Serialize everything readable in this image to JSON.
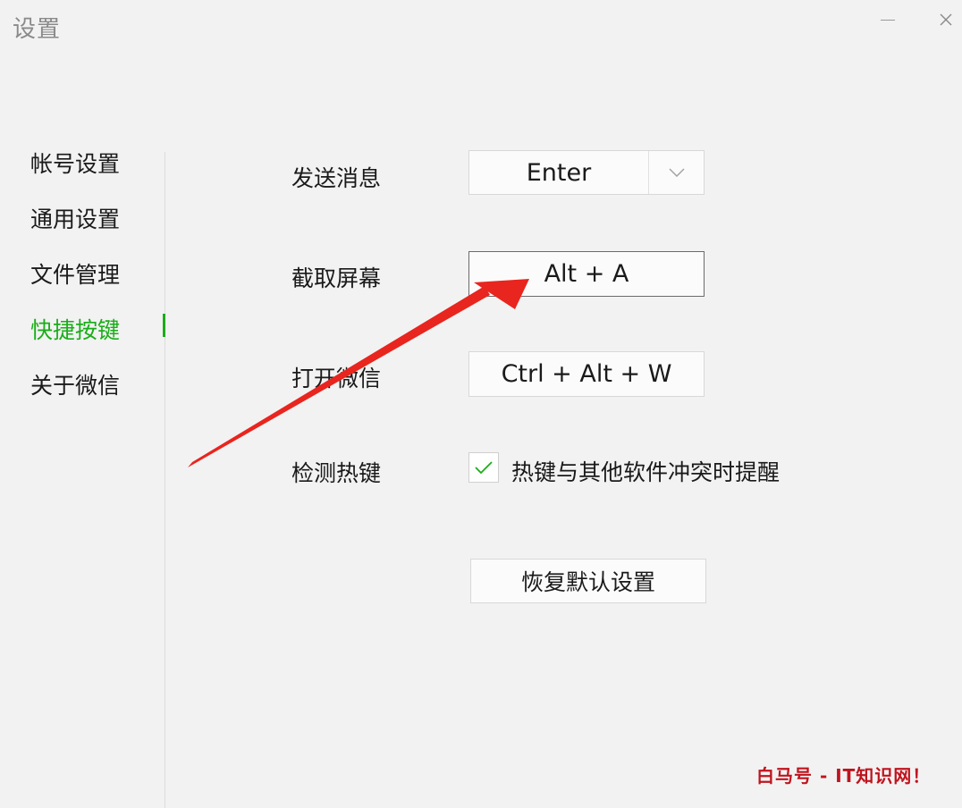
{
  "window": {
    "title": "设置",
    "minimize_icon": "minimize-icon",
    "close_icon": "close-icon"
  },
  "sidebar": {
    "items": [
      {
        "label": "帐号设置",
        "active": false
      },
      {
        "label": "通用设置",
        "active": false
      },
      {
        "label": "文件管理",
        "active": false
      },
      {
        "label": "快捷按键",
        "active": true
      },
      {
        "label": "关于微信",
        "active": false
      }
    ],
    "active_color": "#1aad19"
  },
  "shortcuts": {
    "send_message": {
      "label": "发送消息",
      "value": "Enter",
      "dropdown_icon": "chevron-down-icon"
    },
    "screenshot": {
      "label": "截取屏幕",
      "value": "Alt + A"
    },
    "open_wechat": {
      "label": "打开微信",
      "value": "Ctrl + Alt + W"
    },
    "detect_hotkey": {
      "label": "检测热键",
      "checkbox_label": "热键与其他软件冲突时提醒",
      "checked": true,
      "check_icon": "checkmark-icon"
    }
  },
  "reset_button": {
    "label": "恢复默认设置"
  },
  "annotation": {
    "arrow_icon": "red-arrow-icon",
    "color": "#e8251e"
  },
  "watermark": {
    "text": "白马号 - IT知识网！",
    "color": "#c0141e"
  }
}
